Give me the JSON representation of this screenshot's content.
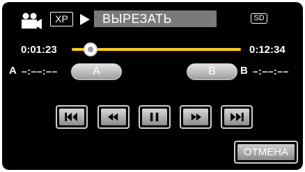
{
  "header": {
    "mode_icon": "video-camera-icon",
    "quality": "XP",
    "status_icon": "play-icon",
    "title": "ВЫРЕЗАТЬ",
    "media_badge": "SD"
  },
  "timeline": {
    "current_time": "0:01:23",
    "total_time": "0:12:34",
    "progress": 0.11,
    "colors": {
      "fill": "#ffd200",
      "track": "#4a4a4a"
    }
  },
  "markers": {
    "a_label": "A",
    "a_time": "–:––:––",
    "a_button": "A",
    "b_button": "B",
    "b_label": "B",
    "b_time": "–:––:––"
  },
  "transport": {
    "buttons": [
      {
        "icon": "skip-back-icon"
      },
      {
        "icon": "rewind-icon"
      },
      {
        "icon": "pause-icon"
      },
      {
        "icon": "fast-forward-icon"
      },
      {
        "icon": "skip-forward-icon"
      }
    ]
  },
  "actions": {
    "cancel_label": "ОТМЕНА"
  }
}
